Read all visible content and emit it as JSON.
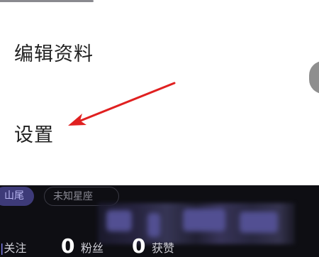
{
  "menu": {
    "items": [
      {
        "label": "编辑资料"
      },
      {
        "label": "设置"
      }
    ]
  },
  "annotation": {
    "arrow_color": "#e02020",
    "points_to": "settings"
  },
  "profile": {
    "tags": [
      {
        "label": "山尾",
        "color": "#3d3a78"
      },
      {
        "label": "未知星座"
      }
    ],
    "stats": [
      {
        "value": "",
        "label": "关注"
      },
      {
        "value": "0",
        "label": "粉丝"
      },
      {
        "value": "0",
        "label": "获赞"
      }
    ],
    "following_label_partial": "关注",
    "following_marker": "|"
  },
  "toggle": {
    "color": "#8f8f8f"
  }
}
